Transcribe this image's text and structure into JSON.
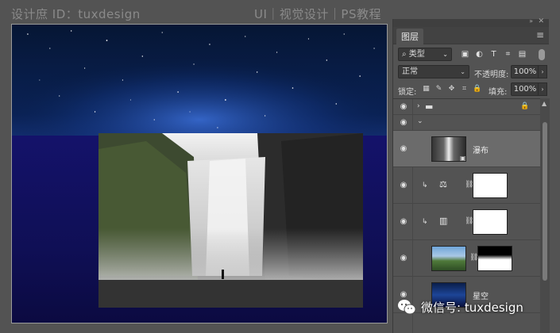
{
  "watermark": {
    "left": "设计庶 ID：tuxdesign",
    "right": "UI｜视觉设计｜PS教程",
    "bottom": "微信号: tuxdesign"
  },
  "panel": {
    "tab_label": "图层",
    "filter": {
      "label": "类型",
      "icons": [
        "image-filter-icon",
        "adjustment-filter-icon",
        "type-filter-icon",
        "shape-filter-icon",
        "smart-object-filter-icon"
      ]
    },
    "blend_mode": "正常",
    "opacity_label": "不透明度:",
    "opacity_value": "100%",
    "lock_label": "锁定:",
    "fill_label": "填充:",
    "fill_value": "100%"
  },
  "layers": [
    {
      "type": "group",
      "name": "",
      "collapsed": true,
      "locked": true
    },
    {
      "type": "group",
      "name": "",
      "collapsed": false
    },
    {
      "type": "smart-object",
      "name": "瀑布",
      "selected": true
    },
    {
      "type": "adjustment",
      "adjustment": "balance",
      "clipped": true,
      "has_mask": true
    },
    {
      "type": "adjustment",
      "adjustment": "levels",
      "clipped": true,
      "has_mask": true
    },
    {
      "type": "image",
      "name": "",
      "has_mask": true
    },
    {
      "type": "image",
      "name": "星空"
    }
  ],
  "colors": {
    "panel_bg": "#535353",
    "selected_layer": "#6b6b6b",
    "sky": "#0a2256",
    "ground": "#14126a"
  }
}
